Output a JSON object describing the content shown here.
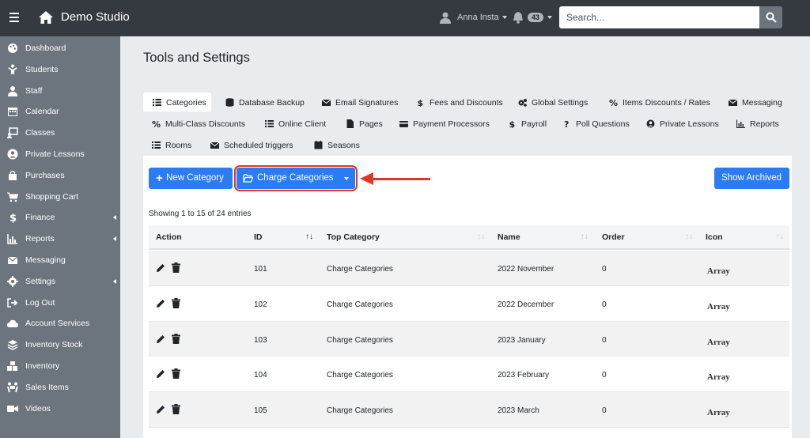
{
  "topbar": {
    "brand": "Demo Studio",
    "user_name": "Anna Insta",
    "notification_count": "43",
    "search_placeholder": "Search..."
  },
  "sidebar": {
    "items": [
      {
        "label": "Dashboard",
        "icon": "palette-icon"
      },
      {
        "label": "Students",
        "icon": "child-icon"
      },
      {
        "label": "Staff",
        "icon": "user-tie-icon"
      },
      {
        "label": "Calendar",
        "icon": "calendar-icon"
      },
      {
        "label": "Classes",
        "icon": "chalkboard-icon"
      },
      {
        "label": "Private Lessons",
        "icon": "user-circle-icon"
      },
      {
        "label": "Purchases",
        "icon": "shopping-bag-icon"
      },
      {
        "label": "Shopping Cart",
        "icon": "cart-icon"
      },
      {
        "label": "Finance",
        "icon": "dollar-icon"
      },
      {
        "label": "Reports",
        "icon": "bar-chart-icon"
      },
      {
        "label": "Messaging",
        "icon": "envelope-icon"
      },
      {
        "label": "Settings",
        "icon": "gear-icon"
      },
      {
        "label": "Log Out",
        "icon": "sign-out-icon"
      },
      {
        "label": "Account Services",
        "icon": "cloud-icon"
      },
      {
        "label": "Inventory Stock",
        "icon": "layers-icon"
      },
      {
        "label": "Inventory",
        "icon": "boxes-icon"
      },
      {
        "label": "Sales Items",
        "icon": "people-carry-icon"
      },
      {
        "label": "Videos",
        "icon": "video-icon"
      }
    ]
  },
  "page_title": "Tools and Settings",
  "tabs": [
    {
      "label": "Categories",
      "icon": "list-icon"
    },
    {
      "label": "Database Backup",
      "icon": "database-icon"
    },
    {
      "label": "Email Signatures",
      "icon": "envelope-icon"
    },
    {
      "label": "Fees and Discounts",
      "icon": "dollar-icon"
    },
    {
      "label": "Global Settings",
      "icon": "cogs-icon"
    },
    {
      "label": "Items Discounts / Rates",
      "icon": "percent-icon"
    },
    {
      "label": "Messaging",
      "icon": "envelope-icon"
    },
    {
      "label": "Multi-Class Discounts",
      "icon": "percent-icon"
    },
    {
      "label": "Online Client",
      "icon": "list-icon"
    },
    {
      "label": "Pages",
      "icon": "file-icon"
    },
    {
      "label": "Payment Processors",
      "icon": "credit-card-icon"
    },
    {
      "label": "Payroll",
      "icon": "dollar-icon"
    },
    {
      "label": "Poll Questions",
      "icon": "question-icon"
    },
    {
      "label": "Private Lessons",
      "icon": "user-circle-icon"
    },
    {
      "label": "Reports",
      "icon": "line-chart-icon"
    },
    {
      "label": "Rooms",
      "icon": "list-icon"
    },
    {
      "label": "Scheduled triggers",
      "icon": "envelope-icon"
    },
    {
      "label": "Seasons",
      "icon": "calendar-icon"
    }
  ],
  "toolbar": {
    "new_category": "New Category",
    "charge_categories": "Charge Categories",
    "show_archived": "Show Archived"
  },
  "table": {
    "showing": "Showing 1 to 15 of 24 entries",
    "headers": [
      "Action",
      "ID",
      "Top Category",
      "Name",
      "Order",
      "Icon"
    ],
    "rows": [
      {
        "id": "101",
        "top_category": "Charge Categories",
        "name": "2022 November",
        "order": "0",
        "icon": "Array"
      },
      {
        "id": "102",
        "top_category": "Charge Categories",
        "name": "2022 December",
        "order": "0",
        "icon": "Array"
      },
      {
        "id": "103",
        "top_category": "Charge Categories",
        "name": "2023 January",
        "order": "0",
        "icon": "Array"
      },
      {
        "id": "104",
        "top_category": "Charge Categories",
        "name": "2023 February",
        "order": "0",
        "icon": "Array"
      },
      {
        "id": "105",
        "top_category": "Charge Categories",
        "name": "2023 March",
        "order": "0",
        "icon": "Array"
      }
    ]
  },
  "colors": {
    "topbar": "#343a40",
    "sidebar": "#6c757d",
    "primary": "#2b7bf2",
    "annotation": "#e0362a"
  }
}
